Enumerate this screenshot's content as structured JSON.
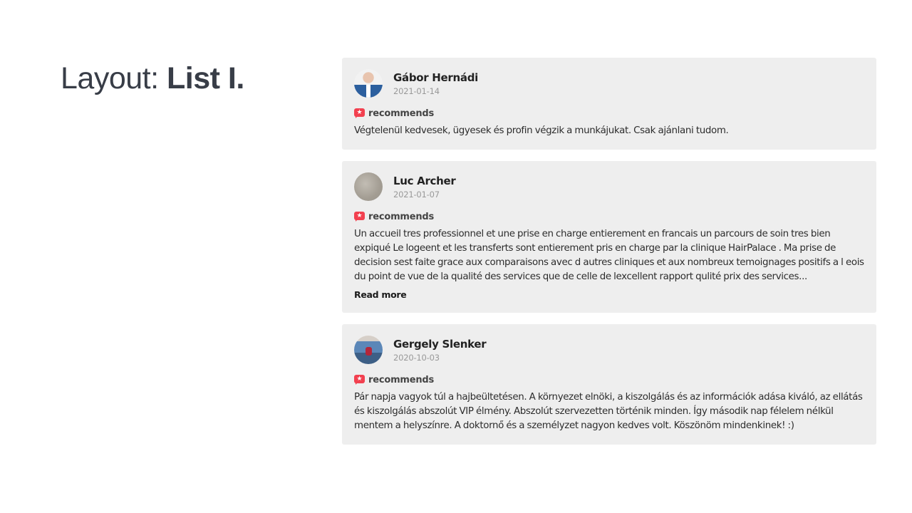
{
  "page": {
    "title_prefix": "Layout: ",
    "title_bold": "List I."
  },
  "reviews": [
    {
      "name": "Gábor Hernádi",
      "date": "2021-01-14",
      "avatar": "portrait-man-suit",
      "badge_icon": "recommend-star-bubble-icon",
      "badge_label": "recommends",
      "text": "Végtelenül kedvesek, ügyesek és profin végzik a munkájukat. Csak ajánlani tudom.",
      "read_more": null
    },
    {
      "name": "Luc Archer",
      "date": "2021-01-07",
      "avatar": "stone-texture",
      "badge_icon": "recommend-star-bubble-icon",
      "badge_label": "recommends",
      "text": "Un accueil tres professionnel et une prise en charge entierement en francais un parcours de soin tres bien expiqué Le logeent et les transferts sont entierement pris en charge par la clinique HairPalace . Ma prise de decision sest faite grace aux comparaisons avec d autres cliniques et aux nombreux temoignages positifs a l eois du point de vue de la qualité des services que de celle de lexcellent rapport qulité prix des services...",
      "read_more": "Read more"
    },
    {
      "name": "Gergely Slenker",
      "date": "2020-10-03",
      "avatar": "person-on-boat",
      "badge_icon": "recommend-star-bubble-icon",
      "badge_label": "recommends",
      "text": "Pár napja vagyok túl a hajbeültetésen. A környezet elnöki, a kiszolgálás és az információk adása kiváló, az ellátás és kiszolgálás abszolút VIP élmény. Abszolút szervezetten történik minden. Így második nap félelem nélkül mentem a helyszínre. A doktornő és a személyzet nagyon kedves volt. Köszönöm mindenkinek! :)",
      "read_more": null
    }
  ],
  "colors": {
    "card_bg": "#eeeeee",
    "badge": "#f2404f",
    "title": "#383d47"
  }
}
